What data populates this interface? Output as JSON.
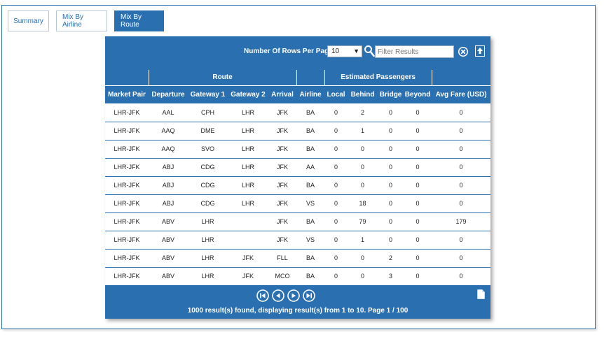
{
  "tabs": [
    {
      "label": "Summary",
      "active": false
    },
    {
      "label": "Mix By Airline",
      "active": false
    },
    {
      "label": "Mix By Route",
      "active": true
    }
  ],
  "toolbar": {
    "rows_label": "Number Of Rows Per Page",
    "rows_value": "10",
    "filter_placeholder": "Filter Results",
    "icons": [
      "search-icon",
      "clear-filter-icon",
      "export-icon"
    ]
  },
  "table": {
    "group_headers": {
      "route": "Route",
      "estimated_passengers": "Estimated Passengers"
    },
    "columns": [
      "Market Pair",
      "Departure",
      "Gateway 1",
      "Gateway 2",
      "Arrival",
      "Airline",
      "Local",
      "Behind",
      "Bridge",
      "Beyond",
      "Avg Fare (USD)"
    ],
    "rows": [
      [
        "LHR-JFK",
        "AAL",
        "CPH",
        "LHR",
        "JFK",
        "BA",
        "0",
        "2",
        "0",
        "0",
        "0"
      ],
      [
        "LHR-JFK",
        "AAQ",
        "DME",
        "LHR",
        "JFK",
        "BA",
        "0",
        "1",
        "0",
        "0",
        "0"
      ],
      [
        "LHR-JFK",
        "AAQ",
        "SVO",
        "LHR",
        "JFK",
        "BA",
        "0",
        "0",
        "0",
        "0",
        "0"
      ],
      [
        "LHR-JFK",
        "ABJ",
        "CDG",
        "LHR",
        "JFK",
        "AA",
        "0",
        "0",
        "0",
        "0",
        "0"
      ],
      [
        "LHR-JFK",
        "ABJ",
        "CDG",
        "LHR",
        "JFK",
        "BA",
        "0",
        "0",
        "0",
        "0",
        "0"
      ],
      [
        "LHR-JFK",
        "ABJ",
        "CDG",
        "LHR",
        "JFK",
        "VS",
        "0",
        "18",
        "0",
        "0",
        "0"
      ],
      [
        "LHR-JFK",
        "ABV",
        "LHR",
        "",
        "JFK",
        "BA",
        "0",
        "79",
        "0",
        "0",
        "179"
      ],
      [
        "LHR-JFK",
        "ABV",
        "LHR",
        "",
        "JFK",
        "VS",
        "0",
        "1",
        "0",
        "0",
        "0"
      ],
      [
        "LHR-JFK",
        "ABV",
        "LHR",
        "JFK",
        "FLL",
        "BA",
        "0",
        "0",
        "2",
        "0",
        "0"
      ],
      [
        "LHR-JFK",
        "ABV",
        "LHR",
        "JFK",
        "MCO",
        "BA",
        "0",
        "0",
        "3",
        "0",
        "0"
      ]
    ]
  },
  "footer": {
    "results_text": "1000 result(s) found, displaying result(s) from 1 to 10. Page 1 / 100",
    "pager_icons": [
      "first-page-icon",
      "previous-page-icon",
      "next-page-icon",
      "last-page-icon"
    ]
  },
  "colors": {
    "accent": "#2a6fb0"
  }
}
